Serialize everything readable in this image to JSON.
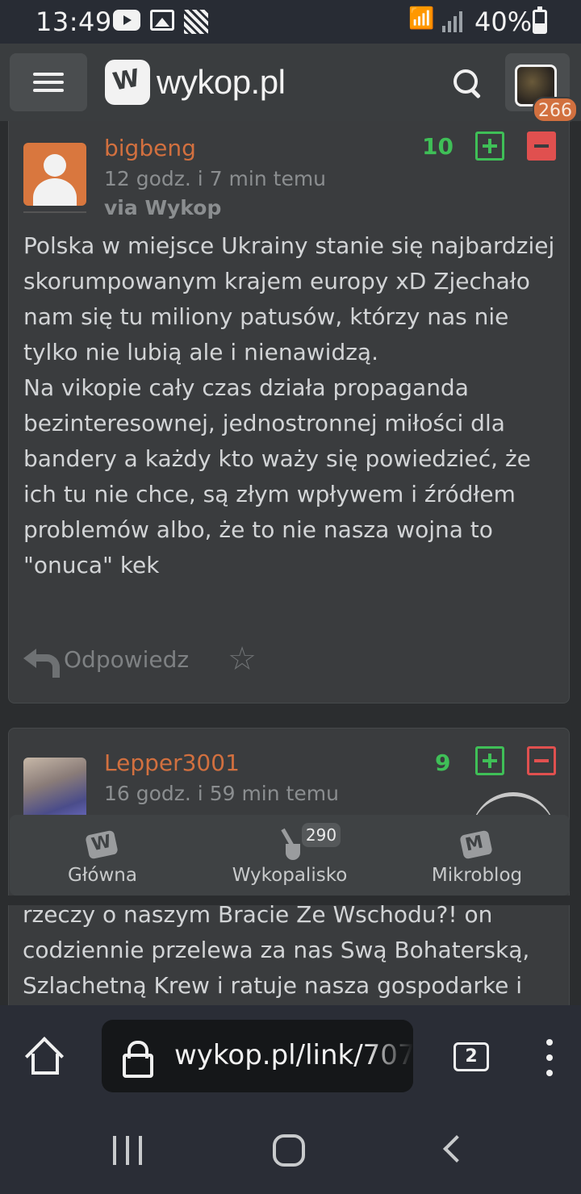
{
  "status_bar": {
    "time": "13:49",
    "battery": "40%"
  },
  "header": {
    "site_name": "wykop.pl",
    "notifications": "266"
  },
  "comments": [
    {
      "username": "bigbeng",
      "time": "12 godz. i 7 min temu",
      "via": "via Wykop",
      "score": "10",
      "body": "Polska w miejsce Ukrainy stanie się najbardziej skorumpowanym krajem europy xD Zjechało nam się tu miliony patusów, którzy nas nie tylko nie lubią ale i nienawidzą.\nNa vikopie cały czas działa propaganda bezinteresownej, jednostronnej miłości dla bandery a każdy kto waży się powiedzieć, że ich tu nie chce, są złym wpływem i źródłem problemów albo, że to nie nasza wojna to \"onuca\" kek",
      "reply_label": "Odpowiedz"
    },
    {
      "username": "Lepper3001",
      "time": "16 godz. i 59 min temu",
      "score": "9",
      "body_continued": "rzeczy o naszym Bracie Ze Wschodu?! on codziennie przelewa za nas Swą Bohaterską, Szlachetną Krew i ratuje nasza gospodarke i"
    }
  ],
  "bottom_tabs": [
    {
      "label": "Główna",
      "icon": "wykop-icon"
    },
    {
      "label": "Wykopalisko",
      "icon": "shovel-icon",
      "count": "290"
    },
    {
      "label": "Mikroblog",
      "icon": "mikroblog-icon"
    }
  ],
  "browser": {
    "url": "wykop.pl/link/707",
    "tab_count": "2"
  },
  "colors": {
    "accent_orange": "#d2703f",
    "vote_green": "#3fbf57",
    "vote_red": "#e0504f"
  }
}
